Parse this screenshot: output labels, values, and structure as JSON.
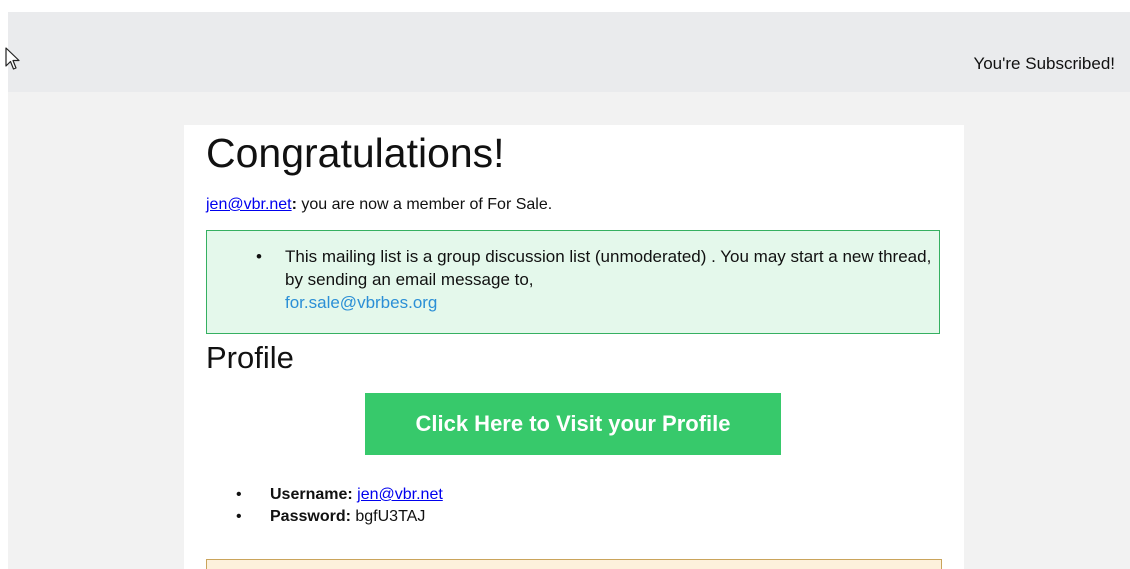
{
  "header": {
    "title": "You're Subscribed!"
  },
  "card": {
    "title": "Congratulations!",
    "member_email": "jen@vbr.net",
    "member_colon": ":",
    "member_text": " you are now a member of For Sale.",
    "info_text": "This mailing list is a group discussion list (unmoderated) . You may start a new thread, by sending an email message to,",
    "list_email": "for.sale@vbrbes.org",
    "profile_heading": "Profile",
    "profile_button_label": "Click Here to Visit your Profile",
    "credentials": {
      "username_label": "Username:",
      "username_value": "jen@vbr.net",
      "password_label": "Password:",
      "password_value": "bgfU3TAJ"
    }
  },
  "icons": {
    "cursor": "mouse-pointer-icon",
    "bullet": "•"
  },
  "colors": {
    "header_bg": "#eaebed",
    "page_bg": "#f2f2f2",
    "info_box_bg": "#e4f8eb",
    "info_box_border": "#35b061",
    "button_bg": "#37c96b",
    "link": "#0000ee",
    "list_email": "#2b8fd6",
    "warning_box_bg": "#fdf1dc",
    "warning_box_border": "#caa45b"
  }
}
